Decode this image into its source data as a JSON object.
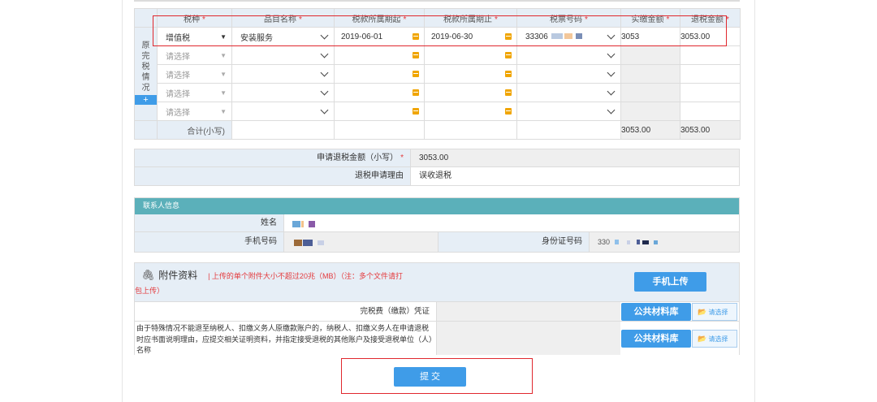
{
  "table": {
    "headers": [
      "税种",
      "品目名称",
      "税款所属期起",
      "税款所属期止",
      "税票号码",
      "实缴金额",
      "退税金额"
    ],
    "side_label": "原完税情况",
    "add_button": "+",
    "row1": {
      "tax_type": "增值税",
      "item_name": "安装服务",
      "period_start": "2019-06-01",
      "period_end": "2019-06-30",
      "ticket_no": "33306",
      "paid_amount": "3053",
      "refund_amount": "3053.00"
    },
    "empty_row_placeholder": "请选择",
    "total_label": "合计(小写)",
    "total_paid": "3053.00",
    "total_refund": "3053.00"
  },
  "refund": {
    "amount_label": "申请退税金额（小写）",
    "amount_value": "3053.00",
    "reason_label": "退税申请理由",
    "reason_value": "误收退税"
  },
  "contact": {
    "section_title": "联系人信息",
    "name_label": "姓名",
    "phone_label": "手机号码",
    "id_label": "身份证号码",
    "id_value_prefix": "330"
  },
  "attachments": {
    "title": "附件资料",
    "note_part1": "| 上传的单个附件大小不超过20兆（MB）（注：多个文件请打",
    "note_part2": "包上传）",
    "mobile_upload_button": "手机上传",
    "row1_label": "完税费（缴款）凭证",
    "row2_label": "由于特殊情况不能退至纳税人、扣缴义务人原缴款账户的，纳税人、扣缴义务人在申请退税时应书面说明理由，应提交相关证明资料，并指定接受退税的其他账户及接受退税单位（人）名称",
    "library_button": "公共材料库",
    "choose_button": "请选择"
  },
  "submit_button": "提 交",
  "colors": {
    "accent_blue": "#3f9ce8",
    "section_teal": "#5bb0ba",
    "highlight_red": "#e0282e",
    "required_red": "#e4393c"
  }
}
